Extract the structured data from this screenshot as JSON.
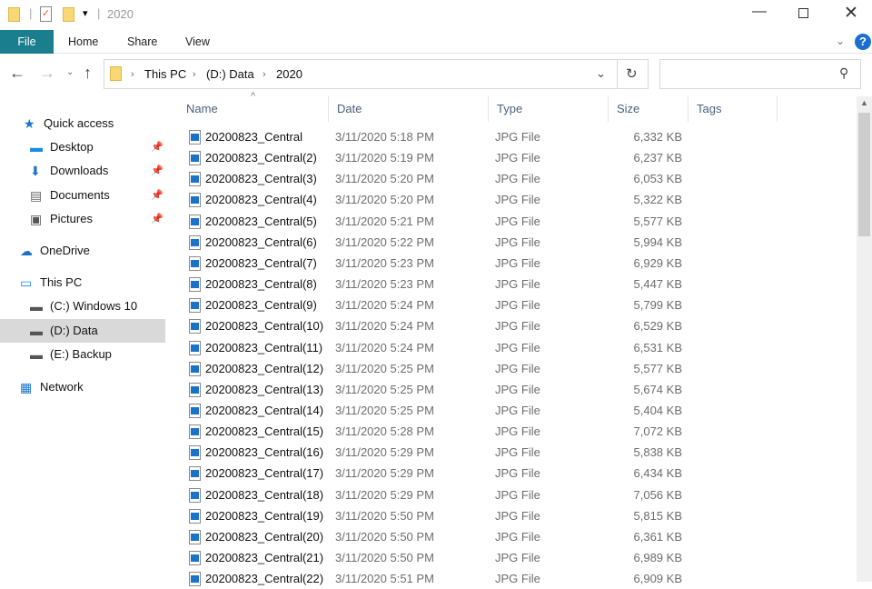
{
  "window": {
    "title": "2020"
  },
  "ribbon": {
    "tabs": [
      "File",
      "Home",
      "Share",
      "View"
    ]
  },
  "address": {
    "crumbs": [
      "This PC",
      "(D:) Data",
      "2020"
    ]
  },
  "search": {
    "placeholder": ""
  },
  "sidebar": {
    "items": [
      {
        "label": "Quick access",
        "icon": "star-icon",
        "pinned": false
      },
      {
        "label": "Desktop",
        "icon": "desktop-icon",
        "pinned": true
      },
      {
        "label": "Downloads",
        "icon": "download-icon",
        "pinned": true
      },
      {
        "label": "Documents",
        "icon": "documents-icon",
        "pinned": true
      },
      {
        "label": "Pictures",
        "icon": "pictures-icon",
        "pinned": true
      },
      {
        "label": "OneDrive",
        "icon": "cloud-icon",
        "pinned": false
      },
      {
        "label": "This PC",
        "icon": "computer-icon",
        "pinned": false
      },
      {
        "label": "(C:) Windows 10",
        "icon": "drive-icon",
        "pinned": false
      },
      {
        "label": "(D:) Data",
        "icon": "drive-icon",
        "pinned": false,
        "selected": true
      },
      {
        "label": "(E:) Backup",
        "icon": "drive-icon",
        "pinned": false
      },
      {
        "label": "Network",
        "icon": "network-icon",
        "pinned": false
      }
    ]
  },
  "columns": [
    "Name",
    "Date",
    "Type",
    "Size",
    "Tags"
  ],
  "files": [
    [
      "20200823_Central",
      "3/11/2020 5:18 PM",
      "JPG File",
      "6,332 KB"
    ],
    [
      "20200823_Central(2)",
      "3/11/2020 5:19 PM",
      "JPG File",
      "6,237 KB"
    ],
    [
      "20200823_Central(3)",
      "3/11/2020 5:20 PM",
      "JPG File",
      "6,053 KB"
    ],
    [
      "20200823_Central(4)",
      "3/11/2020 5:20 PM",
      "JPG File",
      "5,322 KB"
    ],
    [
      "20200823_Central(5)",
      "3/11/2020 5:21 PM",
      "JPG File",
      "5,577 KB"
    ],
    [
      "20200823_Central(6)",
      "3/11/2020 5:22 PM",
      "JPG File",
      "5,994 KB"
    ],
    [
      "20200823_Central(7)",
      "3/11/2020 5:23 PM",
      "JPG File",
      "6,929 KB"
    ],
    [
      "20200823_Central(8)",
      "3/11/2020 5:23 PM",
      "JPG File",
      "5,447 KB"
    ],
    [
      "20200823_Central(9)",
      "3/11/2020 5:24 PM",
      "JPG File",
      "5,799 KB"
    ],
    [
      "20200823_Central(10)",
      "3/11/2020 5:24 PM",
      "JPG File",
      "6,529 KB"
    ],
    [
      "20200823_Central(11)",
      "3/11/2020 5:24 PM",
      "JPG File",
      "6,531 KB"
    ],
    [
      "20200823_Central(12)",
      "3/11/2020 5:25 PM",
      "JPG File",
      "5,577 KB"
    ],
    [
      "20200823_Central(13)",
      "3/11/2020 5:25 PM",
      "JPG File",
      "5,674 KB"
    ],
    [
      "20200823_Central(14)",
      "3/11/2020 5:25 PM",
      "JPG File",
      "5,404 KB"
    ],
    [
      "20200823_Central(15)",
      "3/11/2020 5:28 PM",
      "JPG File",
      "7,072 KB"
    ],
    [
      "20200823_Central(16)",
      "3/11/2020 5:29 PM",
      "JPG File",
      "5,838 KB"
    ],
    [
      "20200823_Central(17)",
      "3/11/2020 5:29 PM",
      "JPG File",
      "6,434 KB"
    ],
    [
      "20200823_Central(18)",
      "3/11/2020 5:29 PM",
      "JPG File",
      "7,056 KB"
    ],
    [
      "20200823_Central(19)",
      "3/11/2020 5:50 PM",
      "JPG File",
      "5,815 KB"
    ],
    [
      "20200823_Central(20)",
      "3/11/2020 5:50 PM",
      "JPG File",
      "6,361 KB"
    ],
    [
      "20200823_Central(21)",
      "3/11/2020 5:50 PM",
      "JPG File",
      "6,989 KB"
    ],
    [
      "20200823_Central(22)",
      "3/11/2020 5:51 PM",
      "JPG File",
      "6,909 KB"
    ]
  ],
  "colors": {
    "file_tab": "#1b7e8f",
    "selected": "#d9d9d9",
    "help": "#1a6fd0"
  }
}
